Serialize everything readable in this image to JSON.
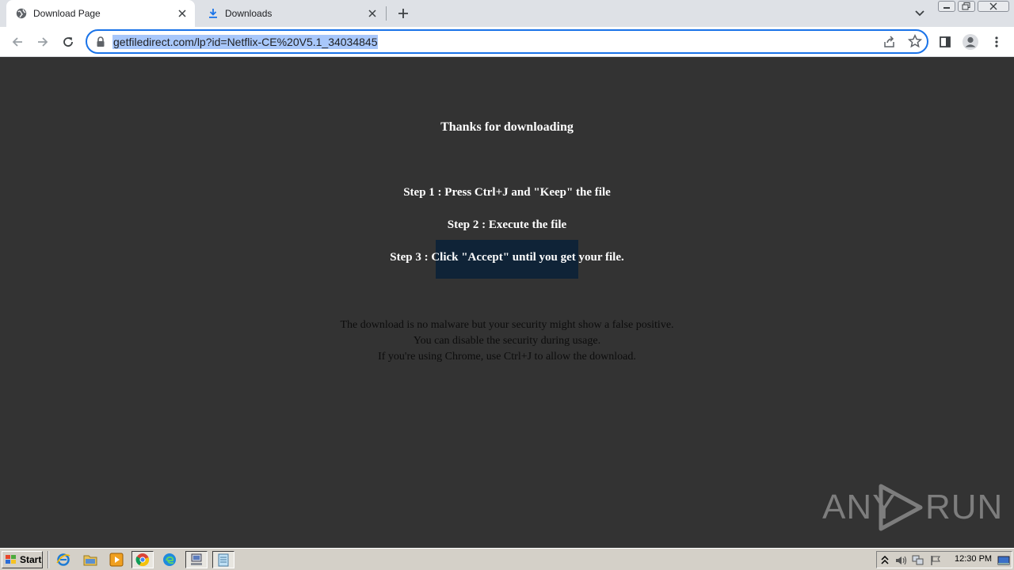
{
  "tabs": [
    {
      "title": "Download Page",
      "icon": "globe-icon",
      "active": true
    },
    {
      "title": "Downloads",
      "icon": "download-icon",
      "active": false
    }
  ],
  "toolbar": {
    "url": "getfiledirect.com/lp?id=Netflix-CE%20V5.1_34034845"
  },
  "page": {
    "heading": "Thanks for downloading",
    "steps": [
      "Step 1 : Press Ctrl+J and \"Keep\" the file",
      "Step 2 : Execute the file",
      "Step 3 : Click \"Accept\" until you get your file."
    ],
    "notes": [
      "The download is no malware but your security might show a false positive.",
      "You can disable the security during usage.",
      "If you're using Chrome, use Ctrl+J to allow the download."
    ],
    "background_color": "#333333"
  },
  "watermark": {
    "left": "ANY",
    "right": "RUN"
  },
  "taskbar": {
    "start_label": "Start",
    "apps": [
      "ie-icon",
      "folder-icon",
      "media-player-icon",
      "chrome-icon",
      "edge-icon",
      "network-app-icon",
      "notepad-icon"
    ],
    "clock": "12:30 PM"
  },
  "colors": {
    "accent": "#1a73e8",
    "url_selection": "#a8c7fa",
    "taskbar": "#d4d0c8"
  }
}
